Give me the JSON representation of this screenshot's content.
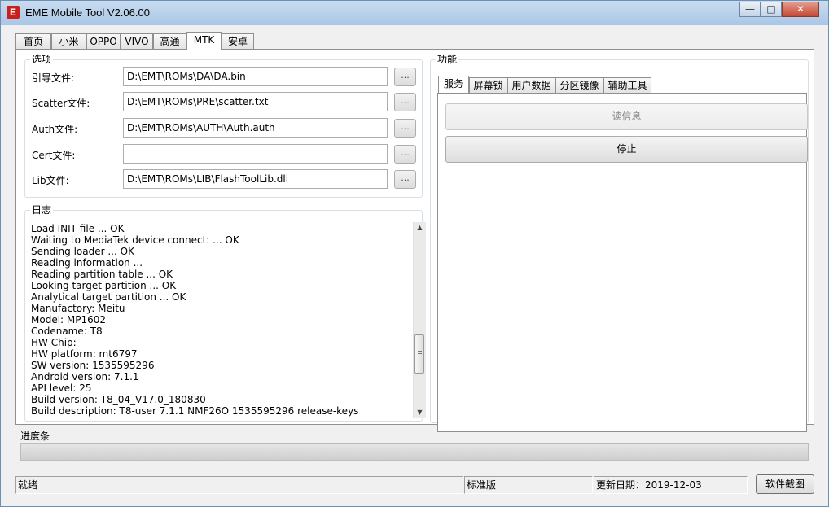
{
  "window": {
    "title": "EME Mobile Tool V2.06.00",
    "icon_letter": "E",
    "icon_color": "#c8201c",
    "minimize_glyph": "—",
    "maximize_glyph": "□",
    "close_glyph": "✕"
  },
  "main_tabs": [
    {
      "label": "首页"
    },
    {
      "label": "小米"
    },
    {
      "label": "OPPO"
    },
    {
      "label": "VIVO"
    },
    {
      "label": "高通"
    },
    {
      "label": "MTK"
    },
    {
      "label": "安卓"
    }
  ],
  "active_main_tab": "MTK",
  "options": {
    "title": "选项",
    "fields": [
      {
        "label": "引导文件:",
        "value": "D:\\EMT\\ROMs\\DA\\DA.bin",
        "button": "..."
      },
      {
        "label": "Scatter文件:",
        "value": "D:\\EMT\\ROMs\\PRE\\scatter.txt",
        "button": "..."
      },
      {
        "label": "Auth文件:",
        "value": "D:\\EMT\\ROMs\\AUTH\\Auth.auth",
        "button": "..."
      },
      {
        "label": "Cert文件:",
        "value": "",
        "button": "..."
      },
      {
        "label": "Lib文件:",
        "value": "D:\\EMT\\ROMs\\LIB\\FlashToolLib.dll",
        "button": "..."
      }
    ]
  },
  "log": {
    "title": "日志",
    "lines": [
      "Load INIT file ... OK",
      "Waiting to MediaTek device connect: ... OK",
      "Sending loader ... OK",
      "Reading information ...",
      "Reading partition table ... OK",
      "Looking target partition ... OK",
      "Analytical target partition ... OK",
      "Manufactory: Meitu",
      "Model: MP1602",
      "Codename: T8",
      "HW Chip:",
      "HW platform: mt6797",
      "SW version: 1535595296",
      "Android version: 7.1.1",
      "API level: 25",
      "Build version: T8_04_V17.0_180830",
      "Build description: T8-user 7.1.1 NMF26O 1535595296 release-keys"
    ]
  },
  "functions": {
    "title": "功能",
    "tabs": [
      {
        "label": "服务"
      },
      {
        "label": "屏幕锁"
      },
      {
        "label": "用户数据"
      },
      {
        "label": "分区镜像"
      },
      {
        "label": "辅助工具"
      }
    ],
    "active_tab": "服务",
    "read_info_button": "读信息",
    "stop_button": "停止"
  },
  "progress": {
    "label": "进度条",
    "fraction": 0
  },
  "status": {
    "state": "就绪",
    "edition": "标准版",
    "update_date": "更新日期：2019-12-03",
    "screenshot_button": "软件截图"
  }
}
